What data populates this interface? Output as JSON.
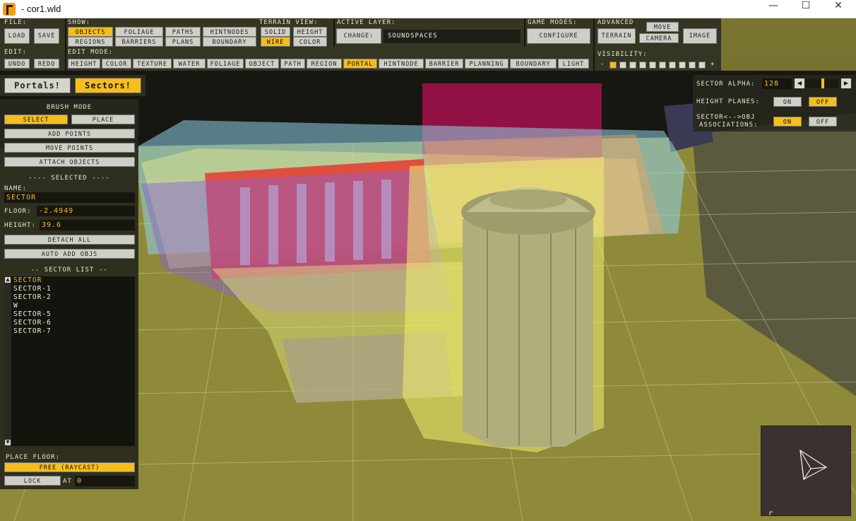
{
  "window": {
    "title": "- cor1.wld",
    "minimize": "—",
    "maximize": "☐",
    "close": "✕"
  },
  "toolbar": {
    "file_label": "File:",
    "load": "Load",
    "save": "Save",
    "edit_label": "Edit:",
    "undo": "Undo",
    "redo": "Redo",
    "show_label": "Show:",
    "show_buttons": [
      "Objects",
      "Foliage",
      "Paths",
      "HintNodes",
      "Regions",
      "Barriers",
      "Plans",
      "Boundary"
    ],
    "terrain_view_label": "Terrain View:",
    "terrain_buttons": [
      "Solid",
      "Height",
      "Wire",
      "Color"
    ],
    "active_layer_label": "Active Layer:",
    "change_label": "Change:",
    "active_layer_value": "SoundSpaces",
    "game_modes_label": "Game Modes:",
    "configure": "Configure",
    "advanced_label": "Advanced",
    "move": "Move",
    "terrain": "Terrain",
    "camera": "Camera",
    "image": "Image",
    "edit_mode_label": "Edit Mode:",
    "edit_modes": [
      "Height",
      "Color",
      "Texture",
      "Water",
      "Foliage",
      "Object",
      "Path",
      "Region",
      "Portal",
      "HintNode",
      "Barrier",
      "Planning",
      "Boundary",
      "Light"
    ],
    "visibility_label": "Visibility:",
    "vis_minus": "-",
    "vis_plus": "+"
  },
  "left_panel": {
    "portals_tab": "Portals!",
    "sectors_tab": "Sectors!",
    "brush_mode_label": "Brush Mode",
    "select": "Select",
    "place": "Place",
    "add_points": "Add Points",
    "move_points": "Move Points",
    "attach_objects": "Attach Objects",
    "selected_label": "---- Selected ----",
    "name_label": "Name:",
    "name_value": "SECTOR",
    "floor_label": "Floor:",
    "floor_value": "-2.4949",
    "height_label": "Height:",
    "height_value": "39.6",
    "detach_all": "Detach All",
    "auto_add_objs": "Auto Add Objs",
    "sector_list_label": "-- Sector List --",
    "sectors": [
      "SECTOR",
      "Sector-1",
      "Sector-2",
      "W",
      "Sector-5",
      "Sector-6",
      "Sector-7"
    ],
    "place_floor_label": "Place Floor:",
    "free_raycast": "Free (Raycast)",
    "lock": "Lock",
    "at_label": "At",
    "at_value": "0"
  },
  "right_panel": {
    "sector_alpha_label": "Sector Alpha:",
    "sector_alpha_value": "128",
    "sector_alpha_fraction": 0.5,
    "height_planes_label": "Height Planes:",
    "on": "On",
    "off": "Off",
    "assoc_label_1": "Sector<-->Obj",
    "assoc_label_2": "Associations:"
  },
  "colors": {
    "accent": "#f6be1c",
    "panel_bg": "#28281e",
    "button": "#cfcfc7"
  }
}
